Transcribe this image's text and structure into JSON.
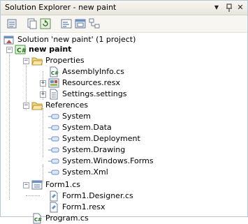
{
  "window": {
    "title": "Solution Explorer - new paint",
    "dropdown_glyph": "▼",
    "pin_glyph": "ᵽ",
    "close_glyph": "✕"
  },
  "toolbar": {
    "buttons": [
      "properties-icon",
      "show-all-files-icon",
      "refresh-icon",
      "view-code-icon",
      "view-designer-icon",
      "class-diagram-icon"
    ]
  },
  "tree": {
    "solution": "Solution 'new paint' (1 project)",
    "project": "new paint",
    "properties": {
      "label": "Properties",
      "children": [
        "AssemblyInfo.cs",
        "Resources.resx",
        "Settings.settings"
      ]
    },
    "references": {
      "label": "References",
      "children": [
        "System",
        "System.Data",
        "System.Deployment",
        "System.Drawing",
        "System.Windows.Forms",
        "System.Xml"
      ]
    },
    "form1": {
      "label": "Form1.cs",
      "children": [
        "Form1.Designer.cs",
        "Form1.resx"
      ]
    },
    "program": "Program.cs"
  },
  "colors": {
    "border": "#b9c6d6",
    "titlebar": "#e8e6dc",
    "folder": "#f3d67a",
    "reference": "#6b8fc7",
    "csharp": "#3a9a3a"
  }
}
